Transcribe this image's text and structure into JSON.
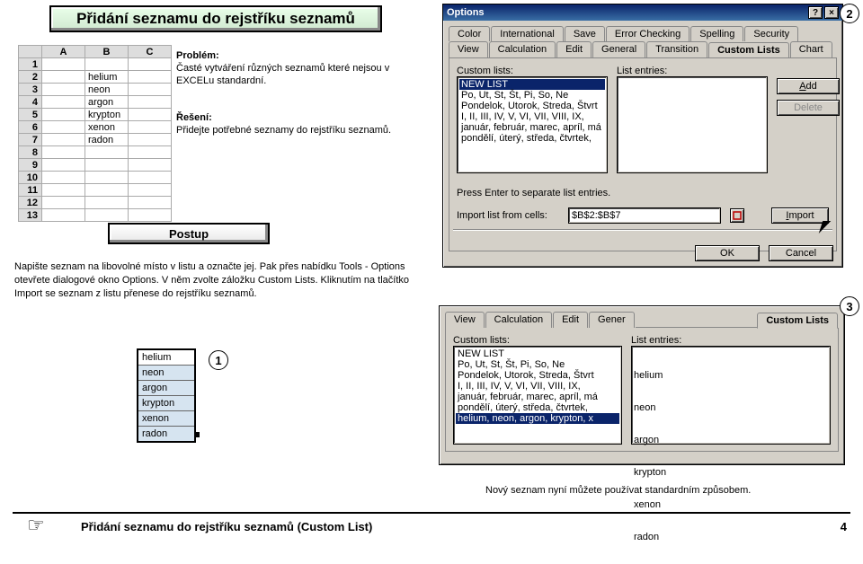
{
  "title_bar": "Přidání seznamu do rejstříku seznamů",
  "spreadsheet": {
    "cols": [
      "A",
      "B",
      "C"
    ],
    "rows": [
      {
        "n": "1",
        "b": ""
      },
      {
        "n": "2",
        "b": "helium"
      },
      {
        "n": "3",
        "b": "neon"
      },
      {
        "n": "4",
        "b": "argon"
      },
      {
        "n": "5",
        "b": "krypton"
      },
      {
        "n": "6",
        "b": "xenon"
      },
      {
        "n": "7",
        "b": "radon"
      },
      {
        "n": "8",
        "b": ""
      },
      {
        "n": "9",
        "b": ""
      },
      {
        "n": "10",
        "b": ""
      },
      {
        "n": "11",
        "b": ""
      },
      {
        "n": "12",
        "b": ""
      },
      {
        "n": "13",
        "b": ""
      }
    ]
  },
  "problem_h": "Problém:",
  "problem_t": "Časté vytváření různých seznamů které nejsou v EXCELu standardní.",
  "reseni_h": "Řešení:",
  "reseni_t": "Přidejte potřebné seznamy do rejstříku seznamů.",
  "postup": "Postup",
  "instructions": "Napište seznam na libovolné místo v listu a označte jej. Pak přes nabídku Tools - Options otevřete dialogové okno Options. V něm zvolte záložku Custom Lists. Kliknutím na tlačítko Import se seznam z listu přenese do rejstříku seznamů.",
  "selection": {
    "top": "helium",
    "items": [
      "neon",
      "argon",
      "krypton",
      "xenon",
      "radon"
    ]
  },
  "dlg": {
    "title": "Options",
    "tabs_row1": [
      "Color",
      "International",
      "Save",
      "Error Checking",
      "Spelling",
      "Security"
    ],
    "tabs_row2": [
      "View",
      "Calculation",
      "Edit",
      "General",
      "Transition",
      "Custom Lists",
      "Chart"
    ],
    "active_tab": "Custom Lists",
    "label_custom": "Custom lists:",
    "label_entries": "List entries:",
    "custom_items": [
      "NEW LIST",
      "Po, Ut, St, Št, Pi, So, Ne",
      "Pondelok, Utorok, Streda, Štvrt",
      "I, II, III, IV, V, VI, VII, VIII, IX,",
      "január, február, marec, apríl, má",
      "pondělí, úterý, středa, čtvrtek,"
    ],
    "entries_text": "",
    "press_enter": "Press Enter to separate list entries.",
    "import_label": "Import list from cells:",
    "range_value": "$B$2:$B$7",
    "btn_add": "Add",
    "btn_delete": "Delete",
    "btn_import": "Import",
    "btn_ok": "OK",
    "btn_cancel": "Cancel"
  },
  "dlg2": {
    "tabs": [
      "View",
      "Calculation",
      "Edit",
      "Gener"
    ],
    "tab_right": "Custom Lists",
    "label_custom": "Custom lists:",
    "label_entries": "List entries:",
    "custom_items": [
      "NEW LIST",
      "Po, Ut, St, Št, Pi, So, Ne",
      "Pondelok, Utorok, Streda, Štvrt",
      "I, II, III, IV, V, VI, VII, VIII, IX,",
      "január, február, marec, apríl, má",
      "pondělí, úterý, středa, čtvrtek,",
      "helium, neon, argon, krypton, x"
    ],
    "entries": [
      "helium",
      "neon",
      "argon",
      "krypton",
      "xenon",
      "radon"
    ]
  },
  "conclusion": "Nový seznam nyní můžete používat standardním způsobem.",
  "footer": {
    "title": "Přidání seznamu do rejstříku seznamů (Custom List)",
    "page": "4",
    "hand": "☞"
  },
  "numbers": {
    "n1": "1",
    "n2": "2",
    "n3": "3"
  }
}
